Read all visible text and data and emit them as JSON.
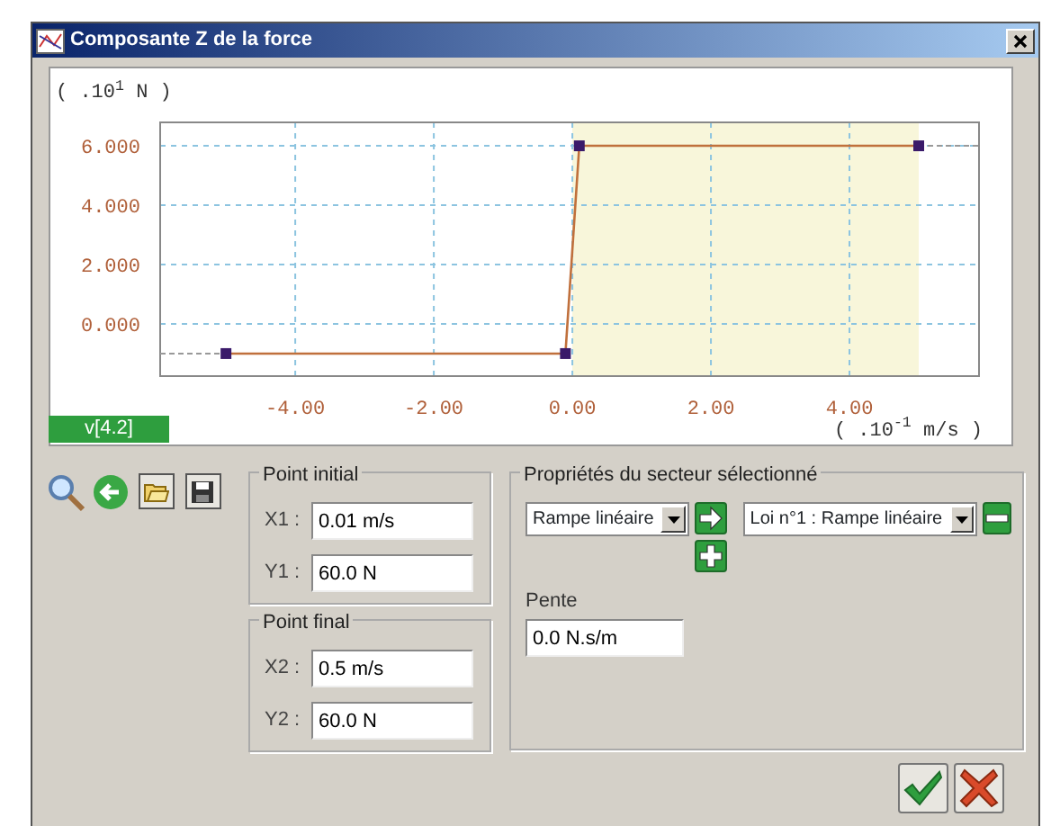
{
  "window": {
    "title": "Composante Z de la force"
  },
  "chart": {
    "chart_data": {
      "type": "line",
      "xlabel": "( .10$^{-1}$ m/s )",
      "ylabel": "( .10$^{1}$ N )",
      "xlim": [
        -5.95,
        5.87
      ],
      "ylim": [
        -1.76,
        6.79
      ],
      "x": [
        -5,
        -0.1,
        0.1,
        5
      ],
      "series": [
        {
          "color": "#c0703c",
          "marker": "square",
          "values": [
            -1,
            -1,
            6,
            6
          ]
        }
      ],
      "xticks": [
        {
          "value": -4,
          "label": "-4.00"
        },
        {
          "value": -2,
          "label": "-2.00"
        },
        {
          "value": 0,
          "label": "0.00"
        },
        {
          "value": 2,
          "label": "2.00"
        },
        {
          "value": 4,
          "label": "4.00"
        }
      ],
      "yticks": [
        {
          "value": 6,
          "label": "6.000"
        },
        {
          "value": 4,
          "label": "4.000"
        },
        {
          "value": 2,
          "label": "2.000"
        },
        {
          "value": 0,
          "label": "0.000"
        }
      ],
      "grid": true,
      "bands": [
        {
          "axis": "x",
          "from": 0,
          "to": 5
        }
      ]
    },
    "status_label": "v[4.2]"
  },
  "point_initial": {
    "title": "Point initial",
    "fields": [
      {
        "label": "X1 :",
        "value": "0.01 m/s"
      },
      {
        "label": "Y1 :",
        "value": "60.0 N"
      }
    ]
  },
  "point_final": {
    "title": "Point final",
    "fields": [
      {
        "label": "X2 :",
        "value": "0.5 m/s"
      },
      {
        "label": "Y2 :",
        "value": "60.0 N"
      }
    ]
  },
  "sector_properties": {
    "title": "Propriétés du secteur sélectionné",
    "type_dropdown": {
      "value": "Rampe linéaire"
    },
    "law_dropdown": {
      "value": "Loi n°1 : Rampe linéaire"
    },
    "slope": {
      "label": "Pente",
      "value": "0.0 N.s/m"
    }
  }
}
